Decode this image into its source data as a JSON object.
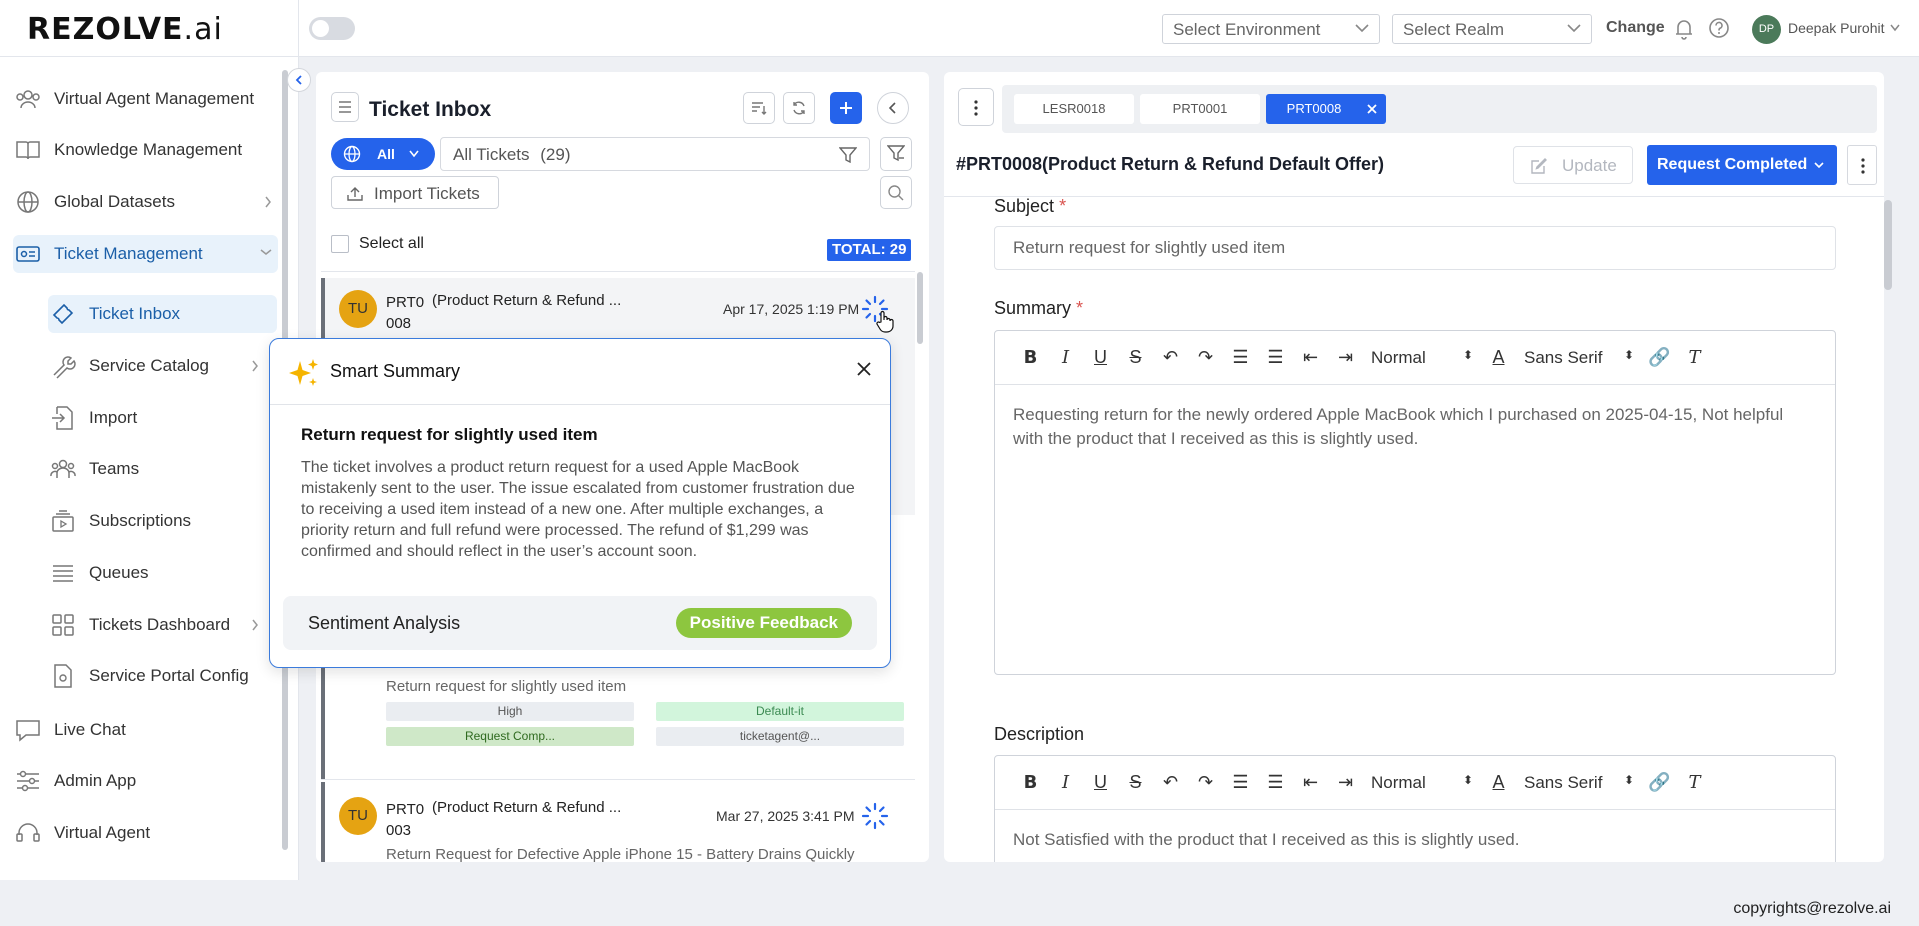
{
  "app": {
    "logo_main": "REZOLVE",
    "logo_suffix": ".ai",
    "env_select": "Select Environment",
    "realm_select": "Select Realm",
    "change_label": "Change",
    "user_initials": "DP",
    "user_name": "Deepak Purohit"
  },
  "sidebar": {
    "items": [
      {
        "label": "Virtual Agent Management"
      },
      {
        "label": "Knowledge Management"
      },
      {
        "label": "Global Datasets"
      },
      {
        "label": "Ticket Management"
      },
      {
        "label": "Ticket Inbox"
      },
      {
        "label": "Service Catalog"
      },
      {
        "label": "Import"
      },
      {
        "label": "Teams"
      },
      {
        "label": "Subscriptions"
      },
      {
        "label": "Queues"
      },
      {
        "label": "Tickets Dashboard"
      },
      {
        "label": "Service Portal Config"
      },
      {
        "label": "Live Chat"
      },
      {
        "label": "Admin App"
      },
      {
        "label": "Virtual Agent"
      }
    ]
  },
  "inbox": {
    "title": "Ticket Inbox",
    "filter_all": "All",
    "all_tickets": "All Tickets",
    "all_tickets_count": "(29)",
    "import_label": "Import Tickets",
    "select_all": "Select all",
    "total": "TOTAL: 29",
    "tickets": [
      {
        "initials": "TU",
        "id_line1": "PRT0",
        "id_line2": "008",
        "title": "(Product Return & Refund ...",
        "date": "Apr 17, 2025 1:19 PM"
      },
      {
        "subtitle": "Return request for slightly used item",
        "priority": "High",
        "group": "Default-it",
        "status": "Request Comp...",
        "agent": "ticketagent@..."
      },
      {
        "initials": "TU",
        "id_line1": "PRT0",
        "id_line2": "003",
        "title": "(Product Return & Refund ...",
        "date": "Mar 27, 2025 3:41 PM",
        "subtitle": "Return Request for Defective Apple iPhone 15 - Battery Drains Quickly"
      }
    ]
  },
  "popover": {
    "title": "Smart Summary",
    "subject": "Return request for slightly used item",
    "body": "The ticket involves a product return request for a used Apple MacBook mistakenly sent to the user. The issue escalated from customer frustration due to receiving a used item instead of a new one. After multiple exchanges, a priority return and full refund were processed. The refund of $1,299 was confirmed and should reflect in the user’s account soon.",
    "sentiment_label": "Sentiment Analysis",
    "sentiment_value": "Positive Feedback"
  },
  "detail": {
    "tabs": [
      "LESR0018",
      "PRT0001",
      "PRT0008"
    ],
    "heading": "#PRT0008(Product Return & Refund Default Offer)",
    "update_label": "Update",
    "request_label": "Request Completed",
    "subject_label": "Subject",
    "subject_value": "Return request for slightly used item",
    "summary_label": "Summary",
    "summary_text": "Requesting return for the newly ordered Apple MacBook which I purchased on 2025-04-15, Not helpful with the product that I received as this is slightly used.",
    "description_label": "Description",
    "description_text": "Not Satisfied with the product that I received as this is slightly used.",
    "toolbar_size": "Normal",
    "toolbar_font": "Sans Serif",
    "required_mark": "*"
  },
  "footer": {
    "copyright": "copyrights@rezolve.ai"
  },
  "colors": {
    "accent": "#2563eb",
    "active_bg": "#e8f2fb",
    "positive": "#8dc63f",
    "avatar": "#e5a312"
  }
}
